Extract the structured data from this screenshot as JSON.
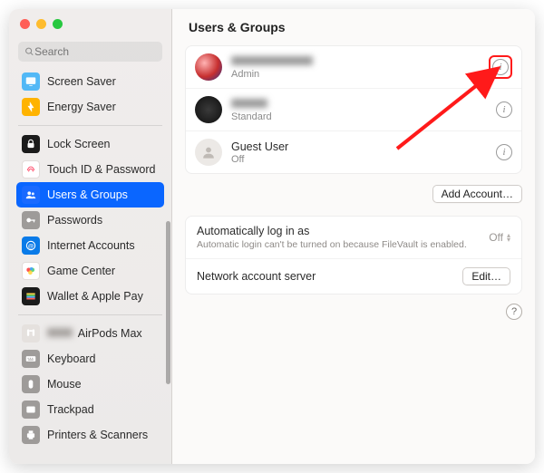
{
  "pane_title": "Users & Groups",
  "search": {
    "placeholder": "Search"
  },
  "sidebar": {
    "items": [
      {
        "label": "Screen Saver",
        "bg": "#52b8f6"
      },
      {
        "label": "Energy Saver",
        "bg": "#ffb300"
      },
      {
        "label": "Lock Screen",
        "bg": "#1b1b1b"
      },
      {
        "label": "Touch ID & Password",
        "bg": "#ffffff"
      },
      {
        "label": "Users & Groups",
        "bg": "#1a6aff"
      },
      {
        "label": "Passwords",
        "bg": "#9e9b99"
      },
      {
        "label": "Internet Accounts",
        "bg": "#0a7be8"
      },
      {
        "label": "Game Center",
        "bg": "#ffffff"
      },
      {
        "label": "Wallet & Apple Pay",
        "bg": "#1b1b1b"
      },
      {
        "label": "AirPods Max",
        "bg": "#d7d3d0",
        "blurPrefix": true
      },
      {
        "label": "Keyboard",
        "bg": "#9e9b99"
      },
      {
        "label": "Mouse",
        "bg": "#9e9b99"
      },
      {
        "label": "Trackpad",
        "bg": "#9e9b99"
      },
      {
        "label": "Printers & Scanners",
        "bg": "#9e9b99"
      }
    ]
  },
  "users": [
    {
      "role": "Admin",
      "nameBlur": true,
      "avatar": "gradient1",
      "highlightInfo": true
    },
    {
      "role": "Standard",
      "nameBlur": true,
      "avatar": "dark"
    },
    {
      "name": "Guest User",
      "role": "Off",
      "avatar": "placeholder"
    }
  ],
  "add_account_label": "Add Account…",
  "settings": {
    "autologin": {
      "title": "Automatically log in as",
      "subtitle": "Automatic login can't be turned on because FileVault is enabled.",
      "value": "Off"
    },
    "network": {
      "title": "Network account server",
      "edit_label": "Edit…"
    }
  }
}
